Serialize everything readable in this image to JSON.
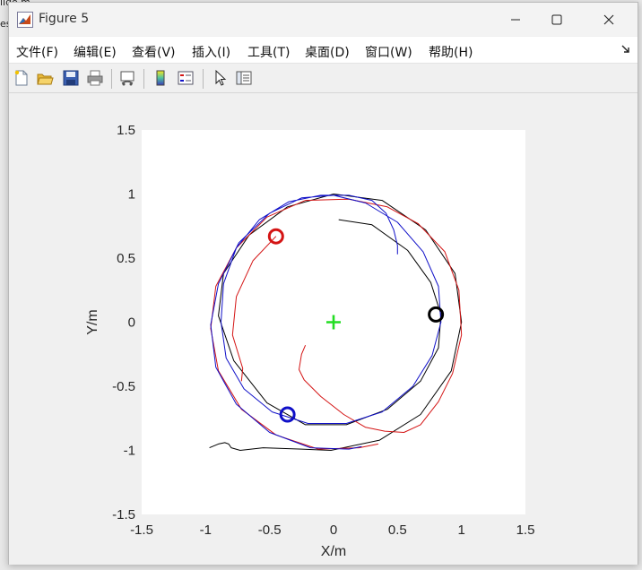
{
  "window": {
    "title": "Figure 5",
    "minimize_icon": "minimize-icon",
    "maximize_icon": "maximize-icon",
    "close_icon": "close-icon"
  },
  "background": {
    "line1": "lido.m",
    "line2": "es"
  },
  "menubar": {
    "items": [
      {
        "label": "文件(F)"
      },
      {
        "label": "编辑(E)"
      },
      {
        "label": "查看(V)"
      },
      {
        "label": "插入(I)"
      },
      {
        "label": "工具(T)"
      },
      {
        "label": "桌面(D)"
      },
      {
        "label": "窗口(W)"
      },
      {
        "label": "帮助(H)"
      }
    ],
    "overflow_icon": "dock-arrow-icon"
  },
  "toolbar": {
    "buttons": [
      {
        "icon": "new-figure-icon"
      },
      {
        "icon": "open-file-icon"
      },
      {
        "icon": "save-icon"
      },
      {
        "icon": "print-icon"
      },
      {
        "icon": "link-plot-icon"
      },
      {
        "icon": "colorbar-icon"
      },
      {
        "icon": "legend-icon"
      },
      {
        "icon": "pointer-icon"
      },
      {
        "icon": "property-inspector-icon"
      }
    ]
  },
  "colors": {
    "red": "#d41414",
    "blue": "#1010c8",
    "black": "#000000",
    "green": "#22dd22"
  },
  "chart_data": {
    "type": "line",
    "title": "",
    "xlabel": "X/m",
    "ylabel": "Y/m",
    "xlim": [
      -1.5,
      1.5
    ],
    "ylim": [
      -1.5,
      1.5
    ],
    "xticks": [
      "-1.5",
      "-1",
      "-0.5",
      "0",
      "0.5",
      "1",
      "1.5"
    ],
    "yticks": [
      "-1.5",
      "-1",
      "-0.5",
      "0",
      "0.5",
      "1",
      "1.5"
    ],
    "grid": false,
    "series": [
      {
        "color": "black",
        "points": [
          [
            0.04,
            0.8
          ],
          [
            0.3,
            0.76
          ],
          [
            0.58,
            0.56
          ],
          [
            0.76,
            0.31
          ],
          [
            0.84,
            0.06
          ],
          [
            0.82,
            -0.2
          ],
          [
            0.68,
            -0.46
          ],
          [
            0.42,
            -0.68
          ],
          [
            0.1,
            -0.8
          ],
          [
            -0.22,
            -0.8
          ],
          [
            -0.52,
            -0.63
          ],
          [
            -0.78,
            -0.3
          ],
          [
            -0.9,
            0.05
          ],
          [
            -0.86,
            0.38
          ],
          [
            -0.66,
            0.68
          ],
          [
            -0.36,
            0.9
          ],
          [
            0.0,
            1.0
          ],
          [
            0.38,
            0.95
          ],
          [
            0.72,
            0.72
          ],
          [
            0.95,
            0.38
          ],
          [
            1.0,
            0.0
          ],
          [
            0.92,
            -0.38
          ],
          [
            0.68,
            -0.72
          ],
          [
            0.36,
            -0.92
          ],
          [
            -0.02,
            -1.0
          ],
          [
            -0.25,
            -0.99
          ],
          [
            -0.55,
            -0.98
          ],
          [
            -0.73,
            -1.0
          ],
          [
            -0.8,
            -0.98
          ],
          [
            -0.82,
            -0.95
          ],
          [
            -0.85,
            -0.94
          ],
          [
            -0.9,
            -0.95
          ],
          [
            -0.97,
            -0.98
          ]
        ]
      },
      {
        "color": "red",
        "points": [
          [
            -0.45,
            0.67
          ],
          [
            -0.63,
            0.48
          ],
          [
            -0.76,
            0.2
          ],
          [
            -0.79,
            -0.1
          ],
          [
            -0.71,
            -0.36
          ],
          [
            -0.72,
            -0.46
          ]
        ]
      },
      {
        "color": "red",
        "points": [
          [
            -0.22,
            -0.18
          ],
          [
            -0.25,
            -0.25
          ],
          [
            -0.27,
            -0.37
          ],
          [
            -0.23,
            -0.45
          ],
          [
            -0.1,
            -0.58
          ],
          [
            0.08,
            -0.72
          ],
          [
            0.25,
            -0.82
          ],
          [
            0.4,
            -0.85
          ],
          [
            0.55,
            -0.86
          ],
          [
            0.68,
            -0.8
          ],
          [
            0.82,
            -0.62
          ],
          [
            0.93,
            -0.4
          ],
          [
            1.0,
            -0.1
          ],
          [
            0.98,
            0.25
          ],
          [
            0.87,
            0.55
          ],
          [
            0.66,
            0.77
          ],
          [
            0.42,
            0.9
          ],
          [
            0.12,
            0.96
          ],
          [
            -0.22,
            0.95
          ],
          [
            -0.52,
            0.82
          ],
          [
            -0.76,
            0.58
          ],
          [
            -0.92,
            0.28
          ],
          [
            -0.96,
            -0.05
          ],
          [
            -0.9,
            -0.38
          ],
          [
            -0.72,
            -0.68
          ],
          [
            -0.45,
            -0.88
          ],
          [
            -0.12,
            -0.99
          ],
          [
            0.2,
            -0.98
          ],
          [
            0.35,
            -0.95
          ]
        ]
      },
      {
        "color": "blue",
        "points": [
          [
            0.5,
            0.53
          ],
          [
            0.5,
            0.6
          ],
          [
            0.47,
            0.72
          ],
          [
            0.41,
            0.85
          ],
          [
            0.3,
            0.95
          ],
          [
            0.12,
            0.99
          ],
          [
            -0.1,
            0.99
          ],
          [
            -0.35,
            0.94
          ],
          [
            -0.58,
            0.8
          ],
          [
            -0.76,
            0.58
          ],
          [
            -0.86,
            0.3
          ],
          [
            -0.88,
            0.0
          ],
          [
            -0.84,
            -0.28
          ],
          [
            -0.7,
            -0.52
          ],
          [
            -0.48,
            -0.7
          ],
          [
            -0.2,
            -0.79
          ],
          [
            0.1,
            -0.79
          ],
          [
            0.38,
            -0.7
          ],
          [
            0.62,
            -0.5
          ],
          [
            0.77,
            -0.26
          ],
          [
            0.84,
            0.0
          ],
          [
            0.82,
            0.28
          ],
          [
            0.7,
            0.55
          ],
          [
            0.5,
            0.78
          ],
          [
            0.25,
            0.93
          ],
          [
            0.0,
            0.99
          ],
          [
            -0.25,
            0.97
          ],
          [
            -0.5,
            0.85
          ],
          [
            -0.74,
            0.62
          ],
          [
            -0.9,
            0.3
          ],
          [
            -0.96,
            -0.02
          ],
          [
            -0.92,
            -0.35
          ],
          [
            -0.76,
            -0.64
          ],
          [
            -0.5,
            -0.86
          ],
          [
            -0.18,
            -0.98
          ],
          [
            0.12,
            -0.99
          ],
          [
            0.22,
            -0.97
          ]
        ]
      }
    ],
    "markers": [
      {
        "type": "circle",
        "color": "red",
        "x": -0.45,
        "y": 0.67
      },
      {
        "type": "circle",
        "color": "black",
        "x": 0.8,
        "y": 0.06
      },
      {
        "type": "circle",
        "color": "blue",
        "x": -0.36,
        "y": -0.72
      },
      {
        "type": "plus",
        "color": "green",
        "x": 0.0,
        "y": 0.0
      }
    ]
  }
}
